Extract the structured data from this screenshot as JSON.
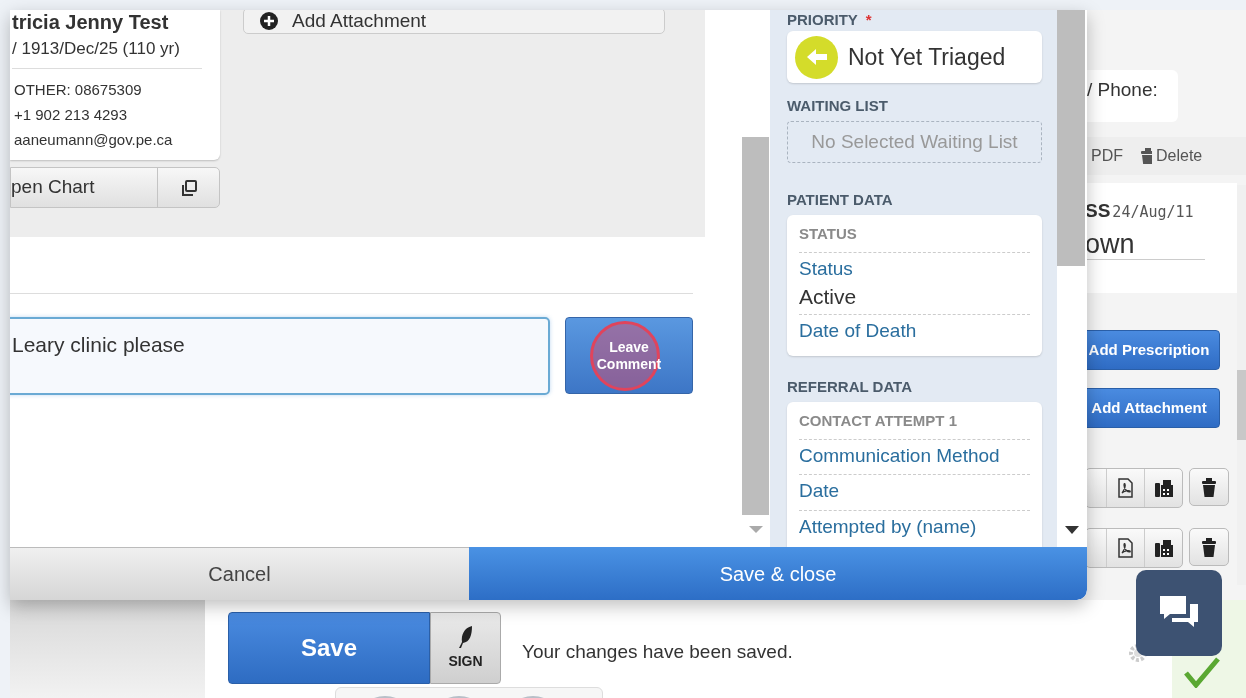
{
  "patient": {
    "name": "tricia Jenny Test",
    "dob": "/ 1913/Dec/25 (110 yr)",
    "contacts": [
      "OTHER: 08675309",
      "+1 902 213 4293",
      "aaneumann@gov.pe.ca"
    ],
    "open_chart": "pen Chart"
  },
  "attachment_button": "Add Attachment",
  "comment": {
    "value": "Leary clinic please",
    "button": "Leave Comment",
    "clicked": true
  },
  "side_panel": {
    "priority": {
      "label": "PRIORITY",
      "required_mark": "*",
      "value": "Not Yet Triaged",
      "color": "#d4dc2a"
    },
    "waiting_list": {
      "label": "WAITING LIST",
      "placeholder": "No Selected Waiting List"
    },
    "sections": [
      {
        "label": "PATIENT DATA",
        "subheading": "STATUS",
        "fields": [
          {
            "label": "Status",
            "value": "Active"
          },
          {
            "label": "Date of Death"
          }
        ]
      },
      {
        "label": "REFERRAL DATA",
        "subheading": "CONTACT ATTEMPT 1",
        "fields": [
          {
            "label": "Communication Method"
          },
          {
            "label": "Date"
          },
          {
            "label": "Attempted by (name)"
          }
        ]
      }
    ]
  },
  "footer": {
    "cancel": "Cancel",
    "save_close": "Save & close"
  },
  "background": {
    "phone_label": "/ Phone:",
    "toolbar": [
      "PDF",
      "Delete"
    ],
    "record_title": "SS",
    "record_date": "24/Aug/11",
    "record_value": "own",
    "buttons": [
      "Add Prescription",
      "Add Attachment"
    ]
  },
  "bottom_bar": {
    "save": "Save",
    "sign": "SIGN",
    "message": "Your changes have been saved.",
    "saved": true
  }
}
